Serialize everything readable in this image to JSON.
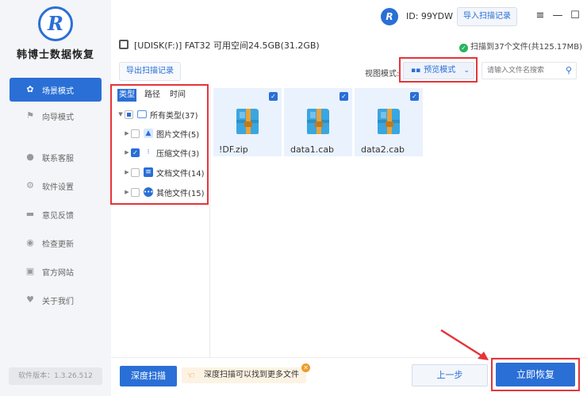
{
  "app": {
    "name": "韩博士数据恢复",
    "version": "软件版本：1.3.26.512"
  },
  "sidebar": {
    "items": [
      {
        "label": "场景模式",
        "icon": "scene-icon",
        "active": true
      },
      {
        "label": "向导模式",
        "icon": "flag-icon",
        "active": false
      },
      {
        "label": "联系客服",
        "icon": "support-icon",
        "active": false
      },
      {
        "label": "软件设置",
        "icon": "gear-icon",
        "active": false
      },
      {
        "label": "意见反馈",
        "icon": "feedback-icon",
        "active": false
      },
      {
        "label": "检查更新",
        "icon": "update-icon",
        "active": false
      },
      {
        "label": "官方网站",
        "icon": "globe-icon",
        "active": false
      },
      {
        "label": "关于我们",
        "icon": "about-icon",
        "active": false
      }
    ]
  },
  "titlebar": {
    "user_id": "ID: 99YDW",
    "import_label": "导入扫描记录"
  },
  "infobar": {
    "disk": "[UDISK(F:)] FAT32 可用空间24.5GB(31.2GB)",
    "scan_summary": "扫描到37个文件(共125.17MB)"
  },
  "toolbar": {
    "export_label": "导出扫描记录",
    "view_label": "视图模式:",
    "view_value": "预览模式",
    "search_placeholder": "请输入文件名搜索"
  },
  "tree": {
    "tabs": [
      "类型",
      "路径",
      "时间"
    ],
    "root": "所有类型(37)",
    "children": [
      "图片文件(5)",
      "压缩文件(3)",
      "文档文件(14)",
      "其他文件(15)"
    ]
  },
  "files": [
    {
      "name": "!DF.zip"
    },
    {
      "name": "data1.cab"
    },
    {
      "name": "data2.cab"
    }
  ],
  "bottom": {
    "deep_scan": "深度扫描",
    "tip": "深度扫描可以找到更多文件",
    "prev": "上一步",
    "recover": "立即恢复"
  },
  "colors": {
    "accent": "#2a6fd6",
    "highlight": "#e5343a",
    "zip_icon": "#3aa6e0"
  }
}
